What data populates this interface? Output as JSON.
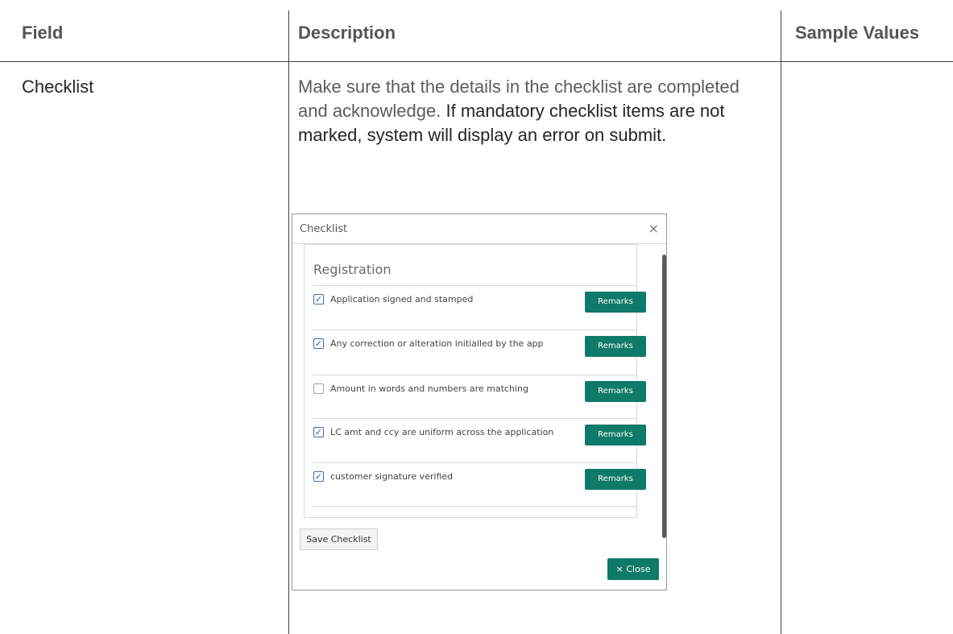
{
  "table": {
    "headers": {
      "field": "Field",
      "description": "Description",
      "sample": "Sample Values"
    },
    "row": {
      "field": "Checklist",
      "description_part1": "Make sure that the details in the checklist are completed and acknowledge.",
      "description_part2": "If mandatory checklist items are not marked, system will display an error on submit.",
      "sample": ""
    }
  },
  "dialog": {
    "title": "Checklist",
    "close_x": "×",
    "section": "Registration",
    "items": [
      {
        "label": "Application signed and stamped",
        "checked": true,
        "button": "Remarks"
      },
      {
        "label": "Any correction or alteration initialled by the  app",
        "checked": true,
        "button": "Remarks"
      },
      {
        "label": "Amount in words and numbers are matching",
        "checked": false,
        "button": "Remarks"
      },
      {
        "label": "LC amt and ccy are uniform across the application",
        "checked": true,
        "button": "Remarks"
      },
      {
        "label": "customer signature verified",
        "checked": true,
        "button": "Remarks"
      }
    ],
    "save_button": "Save Checklist",
    "close_button": "× Close"
  },
  "colors": {
    "accent": "#0f7a6a",
    "checkbox": "#1f5faa"
  }
}
